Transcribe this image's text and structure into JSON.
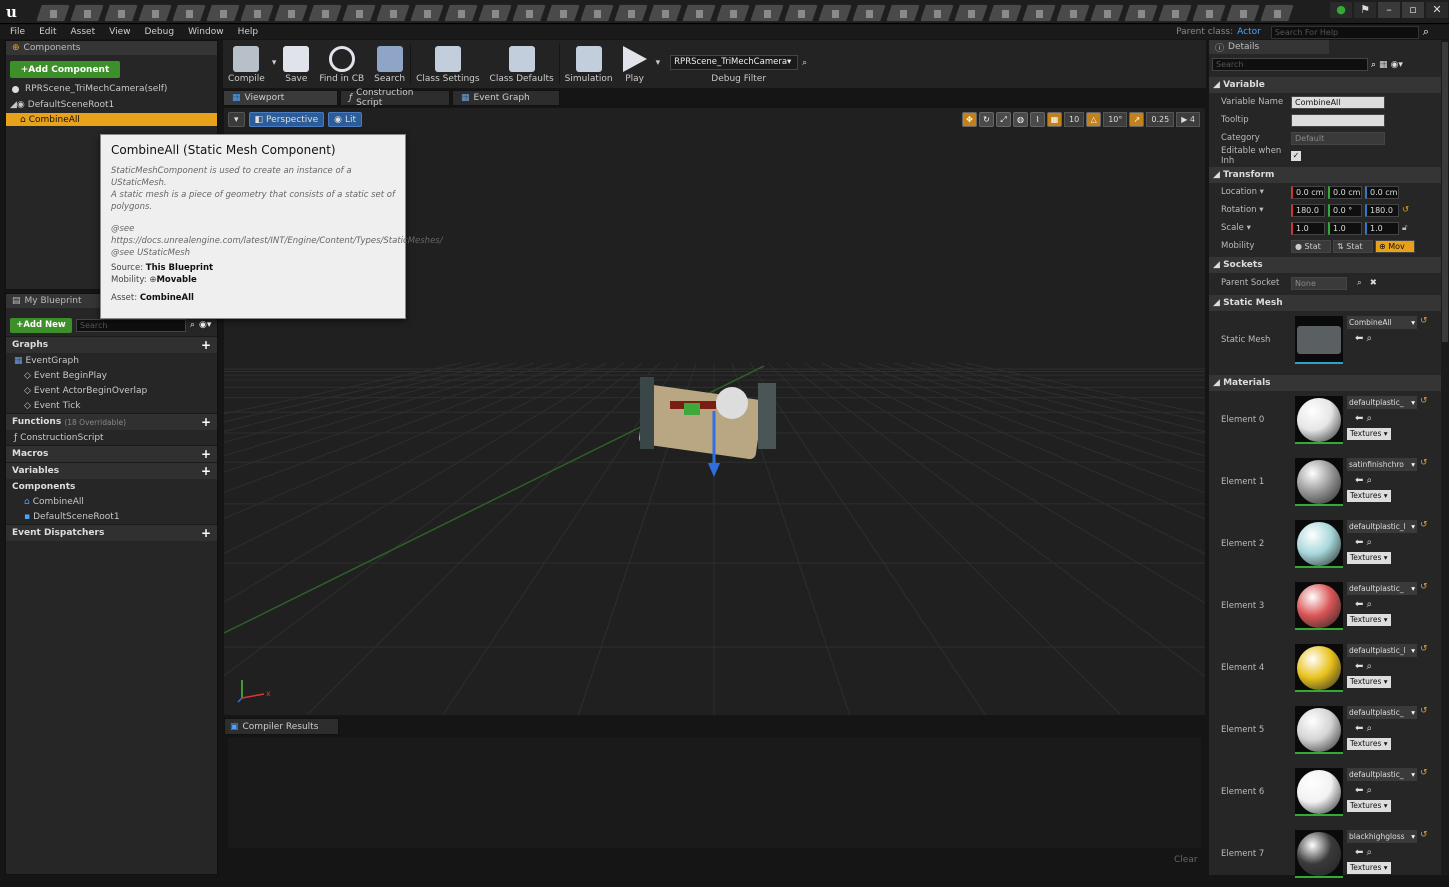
{
  "menu": [
    "File",
    "Edit",
    "Asset",
    "View",
    "Debug",
    "Window",
    "Help"
  ],
  "parent_class": {
    "label": "Parent class:",
    "value": "Actor"
  },
  "help_search": {
    "placeholder": "Search For Help"
  },
  "components": {
    "title": "Components",
    "add_label": "+Add Component",
    "items": [
      "RPRScene_TriMechCamera(self)",
      "DefaultSceneRoot1",
      "CombineAll"
    ]
  },
  "my_blueprint": {
    "title": "My Blueprint",
    "add_label": "+Add New",
    "search_placeholder": "Search",
    "graphs": "Graphs",
    "event_graph": "EventGraph",
    "events": [
      "Event BeginPlay",
      "Event ActorBeginOverlap",
      "Event Tick"
    ],
    "functions": "Functions",
    "functions_count": "(18 Overridable)",
    "construction": "ConstructionScript",
    "macros": "Macros",
    "variables": "Variables",
    "components": "Components",
    "comp_items": [
      "CombineAll",
      "DefaultSceneRoot1"
    ],
    "dispatchers": "Event Dispatchers"
  },
  "toolbar": {
    "items": [
      "Compile",
      "Save",
      "Find in CB",
      "Search",
      "Class Settings",
      "Class Defaults",
      "Simulation",
      "Play"
    ],
    "debug_object": "RPRScene_TriMechCamera▾",
    "debug_filter": "Debug Filter"
  },
  "tabs": [
    "Viewport",
    "Construction Script",
    "Event Graph"
  ],
  "viewport": {
    "perspective": "Perspective",
    "lit": "Lit",
    "grid": "10",
    "angle": "10°",
    "scale": "0.25",
    "cam": "4"
  },
  "tooltip": {
    "title": "CombineAll (Static Mesh Component)",
    "desc1": "StaticMeshComponent is used to create an instance of a UStaticMesh.",
    "desc2": "A static mesh is a piece of geometry that consists of a static set of polygons.",
    "see1": "@see https://docs.unrealengine.com/latest/INT/Engine/Content/Types/StaticMeshes/",
    "see2": "@see UStaticMesh",
    "source_label": "Source:",
    "source": "This Blueprint",
    "mobility_label": "Mobility:",
    "mobility": "Movable",
    "asset_label": "Asset:",
    "asset": "CombineAll"
  },
  "compiler": {
    "title": "Compiler Results",
    "clear": "Clear"
  },
  "details": {
    "title": "Details",
    "search": "Search",
    "variable": "Variable",
    "var_name_label": "Variable Name",
    "var_name": "CombineAll",
    "tooltip_label": "Tooltip",
    "category_label": "Category",
    "category": "Default",
    "editable_label": "Editable when Inh",
    "transform": "Transform",
    "location_label": "Location ▾",
    "location": [
      "0.0 cm",
      "0.0 cm",
      "0.0 cm"
    ],
    "rotation_label": "Rotation ▾",
    "rotation": [
      "180.0",
      "0.0 °",
      "180.0"
    ],
    "scale_label": "Scale ▾",
    "scale": [
      "1.0",
      "1.0",
      "1.0"
    ],
    "mobility_label": "Mobility",
    "mobility": [
      "Stat",
      "Stat",
      "Mov"
    ],
    "sockets": "Sockets",
    "parent_socket_label": "Parent Socket",
    "parent_socket": "None",
    "static_mesh": "Static Mesh",
    "static_mesh_label": "Static Mesh",
    "mesh_name": "CombineAll",
    "materials": "Materials",
    "textures": "Textures ▾",
    "elements": [
      {
        "label": "Element 0",
        "name": "defaultplastic_",
        "color": "#e6e6e6"
      },
      {
        "label": "Element 1",
        "name": "satinfinishchro",
        "color": "#9a9a9a"
      },
      {
        "label": "Element 2",
        "name": "defaultplastic_l",
        "color": "#a8d8dc"
      },
      {
        "label": "Element 3",
        "name": "defaultplastic_",
        "color": "#d95555"
      },
      {
        "label": "Element 4",
        "name": "defaultplastic_l",
        "color": "#e8c21c"
      },
      {
        "label": "Element 5",
        "name": "defaultplastic_",
        "color": "#d4d4d4"
      },
      {
        "label": "Element 6",
        "name": "defaultplastic_",
        "color": "#f2f2f2"
      },
      {
        "label": "Element 7",
        "name": "blackhighgloss",
        "color": "#3a3a3a"
      }
    ]
  }
}
